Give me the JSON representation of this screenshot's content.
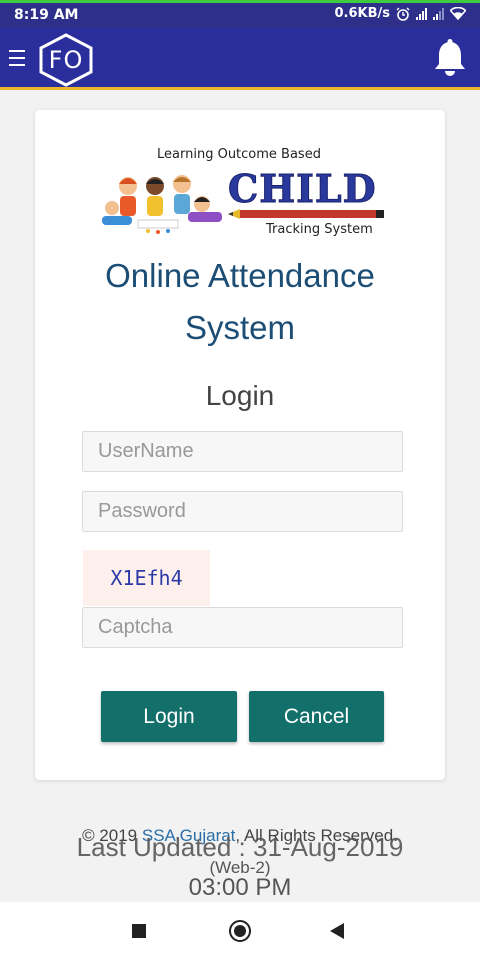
{
  "status_bar": {
    "time": "8:19 AM",
    "net_speed": "0.6KB/s"
  },
  "app_bar": {
    "logo_text": "FO",
    "icons": [
      "menu-icon",
      "bell-icon"
    ]
  },
  "branding": {
    "tagline": "Learning Outcome Based",
    "name": "CHILD",
    "subline": "Tracking System"
  },
  "card": {
    "title_line1": "Online Attendance",
    "title_line2": "System",
    "subtitle": "Login",
    "username_placeholder": "UserName",
    "password_placeholder": "Password",
    "captcha_text": "X1Efh4",
    "captcha_placeholder": "Captcha",
    "login_label": "Login",
    "cancel_label": "Cancel"
  },
  "footer": {
    "copyright_prefix": "© 2019 ",
    "copyright_link": "SSA Gujarat",
    "copyright_suffix": ", All Rights Reserved.",
    "last_updated": "Last Updated : 31-Aug-2019",
    "web": "(Web-2)",
    "time": "03:00 PM"
  },
  "colors": {
    "status_bar": "#2d2f8a",
    "app_bar": "#2a2e9c",
    "app_bar_border": "#e8b82a",
    "title": "#1c4d75",
    "button": "#136f6a",
    "captcha_bg": "#fdf0ec"
  }
}
